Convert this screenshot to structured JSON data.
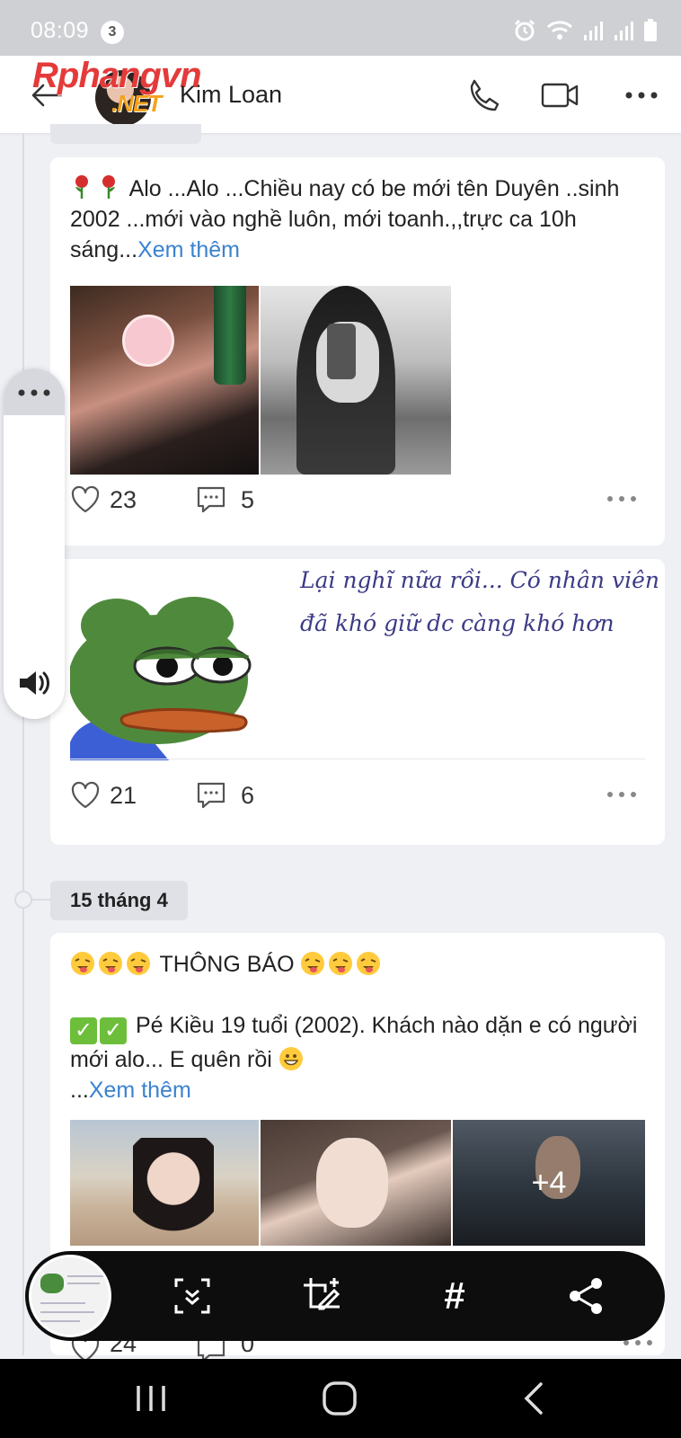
{
  "status_bar": {
    "time": "08:09",
    "notification_count": "3",
    "icons": [
      "alarm-icon",
      "wifi-icon",
      "signal-icon",
      "signal-icon",
      "battery-icon"
    ]
  },
  "watermark": {
    "brand": "Rphangvn",
    "suffix": ".NET"
  },
  "header": {
    "contact_name": "Kim Loan",
    "icons": [
      "back-arrow-icon",
      "phone-icon",
      "video-call-icon",
      "more-dots-icon"
    ]
  },
  "posts": [
    {
      "text": "Alo ...Alo ...Chiều nay có be mới tên Duyên ..sinh 2002 ...mới vào nghề luôn, mới toanh.,,trực ca 10h sáng...",
      "see_more": "Xem thêm",
      "likes": "23",
      "comments": "5"
    },
    {
      "meme_text": "Lại nghĩ nữa rồi... Có nhân viên đã khó giữ dc càng khó hơn",
      "likes": "21",
      "comments": "6"
    },
    {
      "date_label": "15 tháng 4",
      "heading": "THÔNG BÁO",
      "text": "Pé Kiều 19 tuổi (2002). Khách nào dặn e có người mới alo... E quên rồi",
      "see_more_prefix": "...",
      "see_more": "Xem thêm",
      "more_photos": "+4",
      "likes": "24",
      "comments": "0"
    }
  ],
  "colors": {
    "accent_link": "#3b82d0",
    "toolbar_bg": "#0d0d0d",
    "meme_text": "#3c3a86"
  }
}
